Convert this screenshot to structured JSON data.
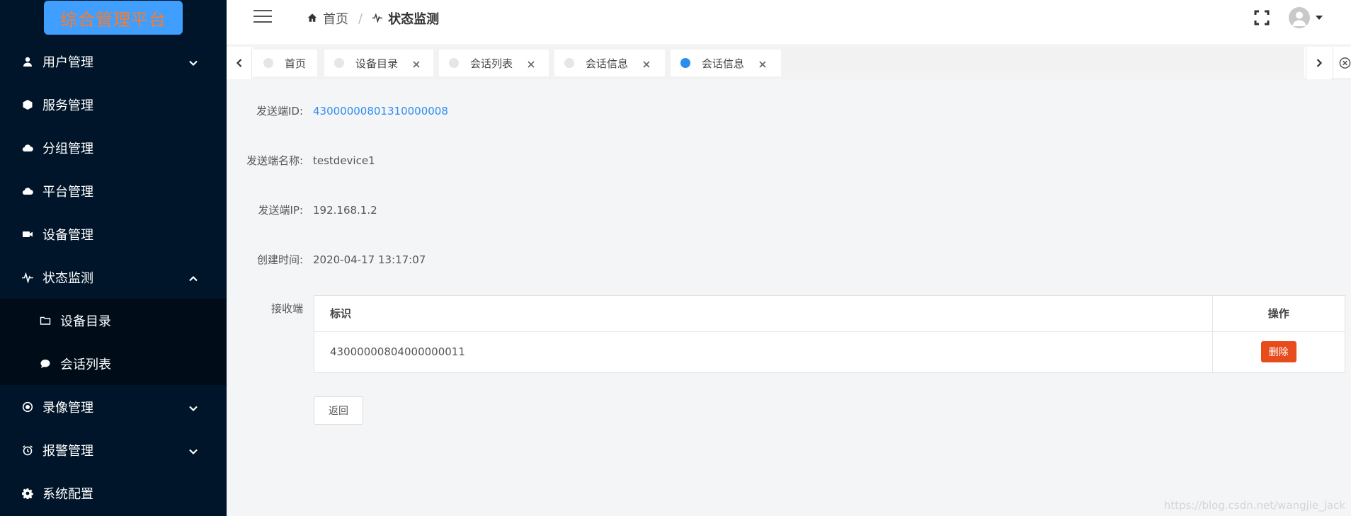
{
  "logo": {
    "text": "综合管理平台"
  },
  "sidebar": {
    "items": [
      {
        "label": "用户管理",
        "icon": "user-icon",
        "chevron": "down"
      },
      {
        "label": "服务管理",
        "icon": "cube-icon"
      },
      {
        "label": "分组管理",
        "icon": "cloud-icon"
      },
      {
        "label": "平台管理",
        "icon": "cloud-icon"
      },
      {
        "label": "设备管理",
        "icon": "video-camera-icon"
      },
      {
        "label": "状态监测",
        "icon": "pulse-icon",
        "chevron": "up"
      },
      {
        "label": "录像管理",
        "icon": "record-icon",
        "chevron": "down"
      },
      {
        "label": "报警管理",
        "icon": "alarm-clock-icon",
        "chevron": "down"
      },
      {
        "label": "系统配置",
        "icon": "gear-icon"
      }
    ],
    "submenu": [
      {
        "label": "设备目录",
        "icon": "folder-icon"
      },
      {
        "label": "会话列表",
        "icon": "chat-icon"
      }
    ]
  },
  "header": {
    "breadcrumb": {
      "home": "首页",
      "current": "状态监测"
    }
  },
  "tags": [
    {
      "label": "首页",
      "closable": false,
      "active": false
    },
    {
      "label": "设备目录",
      "closable": true,
      "active": false
    },
    {
      "label": "会话列表",
      "closable": true,
      "active": false
    },
    {
      "label": "会话信息",
      "closable": true,
      "active": false
    },
    {
      "label": "会话信息",
      "closable": true,
      "active": true
    }
  ],
  "detail": {
    "sender_id_label": "发送端ID:",
    "sender_id": "43000000801310000008",
    "sender_name_label": "发送端名称:",
    "sender_name": "testdevice1",
    "sender_ip_label": "发送端IP:",
    "sender_ip": "192.168.1.2",
    "created_label": "创建时间:",
    "created": "2020-04-17 13:17:07",
    "receiver_label": "接收端"
  },
  "receiver_table": {
    "columns": [
      "标识",
      "操作"
    ],
    "rows": [
      {
        "id": "43000000804000000011",
        "action": "删除"
      }
    ]
  },
  "back_button": "返回",
  "watermark": "https://blog.csdn.net/wangjie_jack",
  "colors": {
    "sidebar_bg": "#001529",
    "accent": "#2d8cf0",
    "logo_bg": "#409eff",
    "logo_text": "#ff7a22",
    "danger": "#e74c1c"
  }
}
